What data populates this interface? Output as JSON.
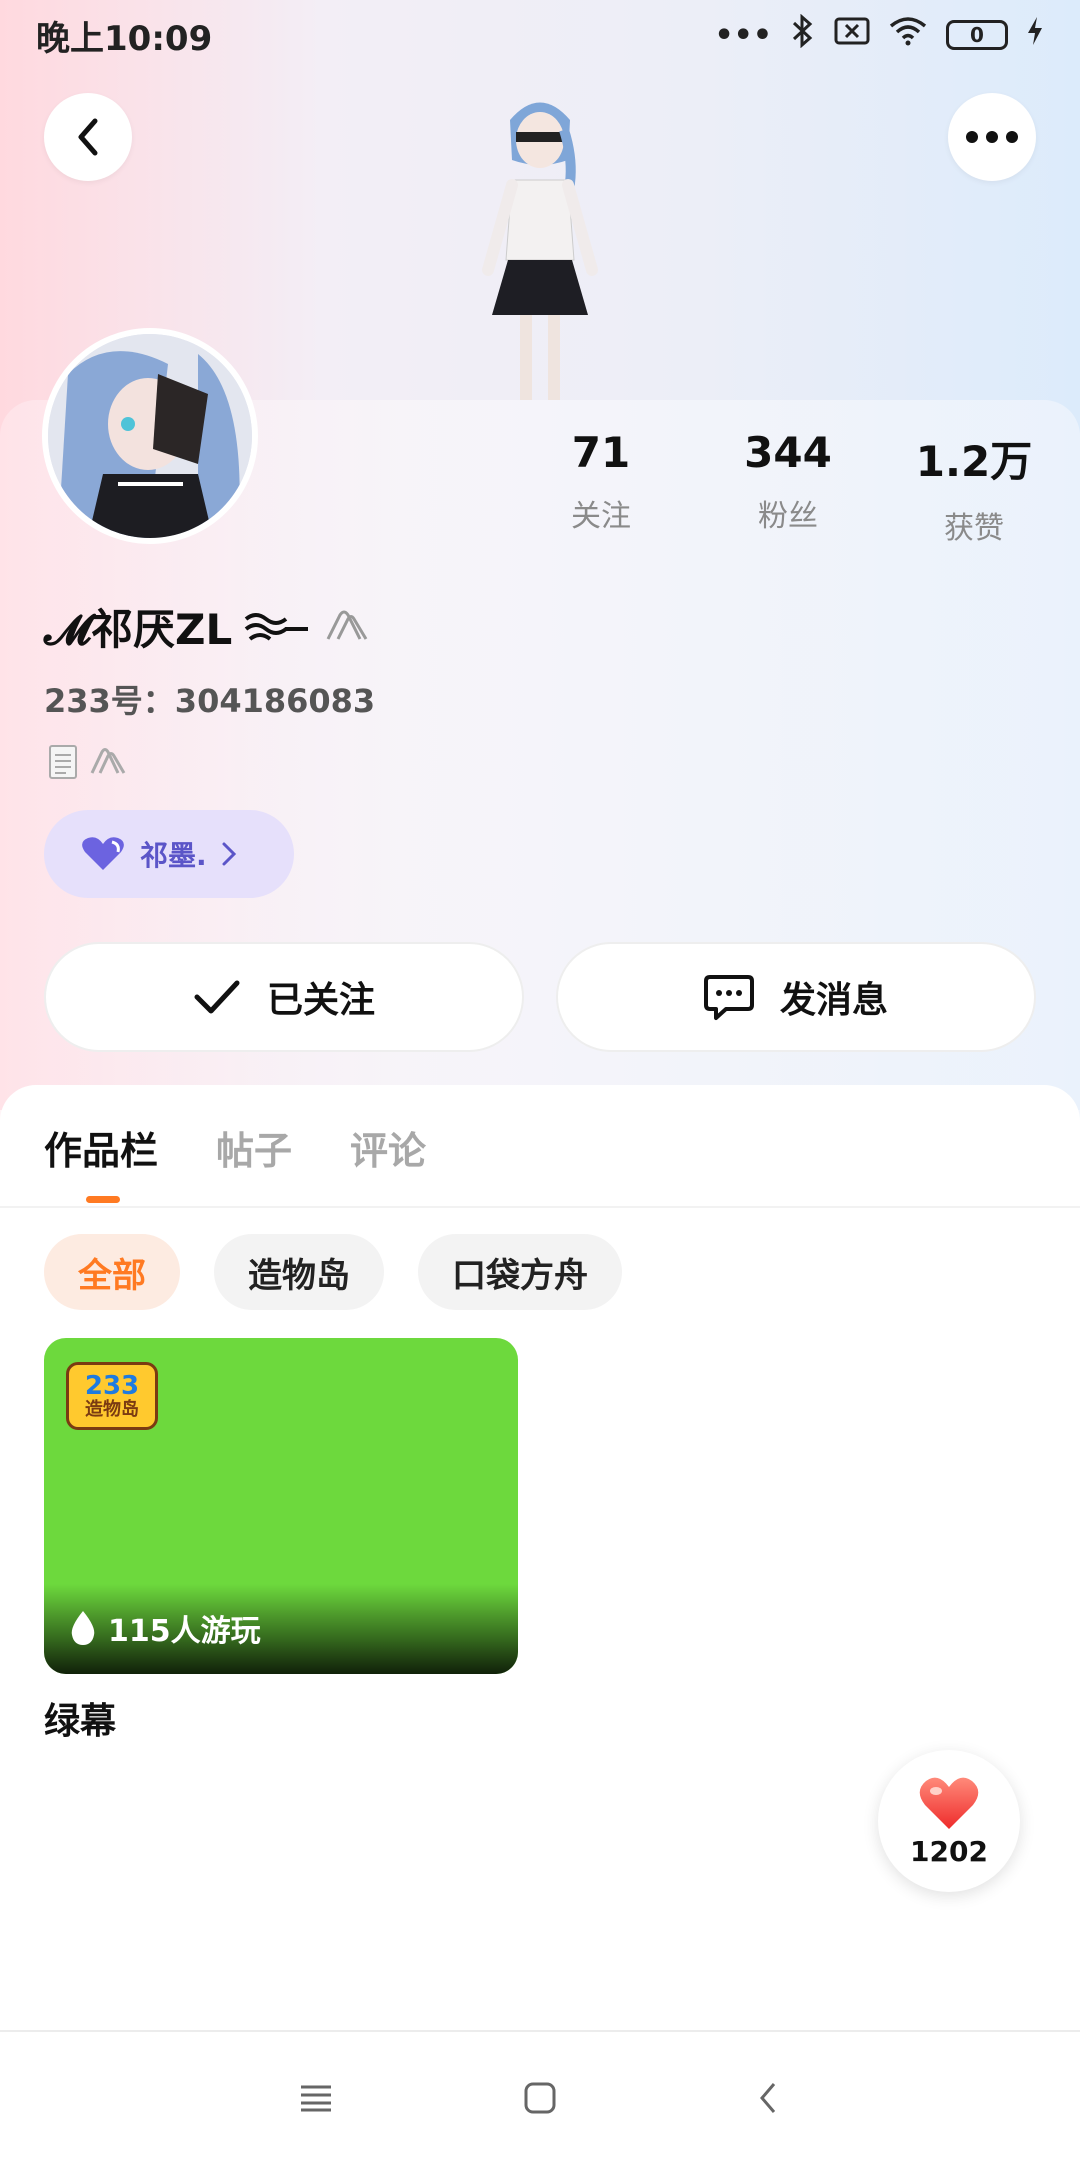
{
  "status_bar": {
    "time": "晚上10:09",
    "battery": "0"
  },
  "profile": {
    "nickname": "𝓜祁厌ZL",
    "id_label": "233号：304186083",
    "tag_label": "祁墨.",
    "stats": [
      {
        "value": "71",
        "label": "关注"
      },
      {
        "value": "344",
        "label": "粉丝"
      },
      {
        "value": "1.2万",
        "label": "获赞"
      }
    ]
  },
  "actions": {
    "follow_label": "已关注",
    "message_label": "发消息"
  },
  "tabs": [
    {
      "label": "作品栏"
    },
    {
      "label": "帖子"
    },
    {
      "label": "评论"
    }
  ],
  "filters": [
    {
      "label": "全部"
    },
    {
      "label": "造物岛"
    },
    {
      "label": "口袋方舟"
    }
  ],
  "works": [
    {
      "title": "绿幕",
      "plays": "115人游玩",
      "logo_number": "233",
      "logo_text": "造物岛",
      "cover_color": "#6dd93d"
    }
  ],
  "like_fab": {
    "count": "1202"
  },
  "colors": {
    "accent": "#ff7a22",
    "tag_bg": "#e6e0fb",
    "tag_text": "#5b55c8"
  }
}
